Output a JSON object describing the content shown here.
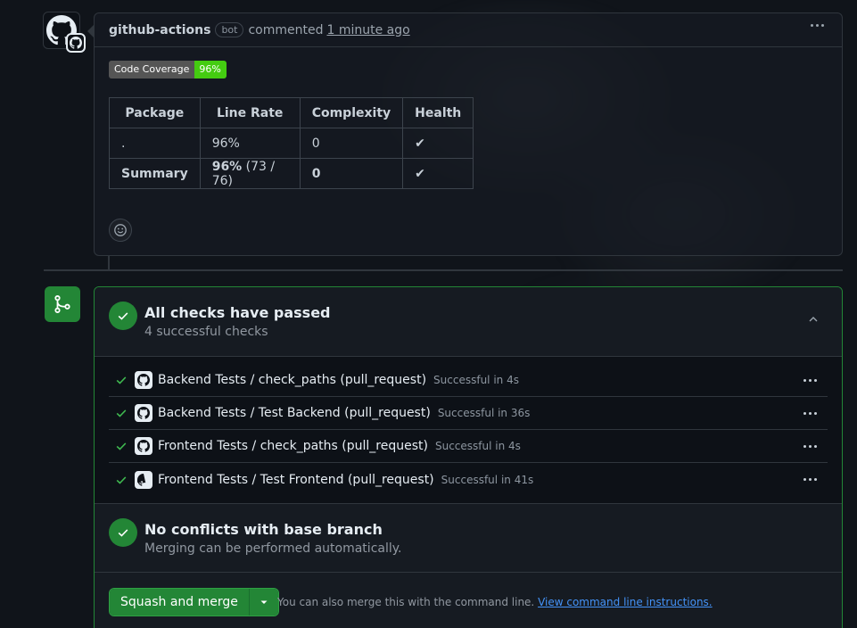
{
  "comment": {
    "author": "github-actions",
    "author_badge": "bot",
    "action": "commented",
    "time": "1 minute ago",
    "coverage_badge": {
      "label": "Code Coverage",
      "value": "96%"
    },
    "table": {
      "headers": [
        "Package",
        "Line Rate",
        "Complexity",
        "Health"
      ],
      "rows": [
        {
          "package": ".",
          "line_rate": "96%",
          "line_extra": "",
          "complexity": "0",
          "health": "✔"
        },
        {
          "package": "Summary",
          "line_rate": "96%",
          "line_extra": " (73 / 76)",
          "complexity": "0",
          "health": "✔"
        }
      ]
    }
  },
  "checks": {
    "title": "All checks have passed",
    "subtitle": "4 successful checks",
    "items": [
      {
        "name": "Backend Tests / check_paths (pull_request)",
        "status": "Successful in 4s"
      },
      {
        "name": "Backend Tests / Test Backend (pull_request)",
        "status": "Successful in 36s"
      },
      {
        "name": "Frontend Tests / check_paths (pull_request)",
        "status": "Successful in 4s"
      },
      {
        "name": "Frontend Tests / Test Frontend (pull_request)",
        "status": "Successful in 41s"
      }
    ]
  },
  "conflicts": {
    "title": "No conflicts with base branch",
    "subtitle": "Merging can be performed automatically."
  },
  "merge": {
    "button_label": "Squash and merge",
    "cli_text": "You can also merge this with the command line. ",
    "cli_link": "View command line instructions."
  },
  "colors": {
    "success": "#238636",
    "link": "#4493f8",
    "badge_value": "#44cc11"
  }
}
